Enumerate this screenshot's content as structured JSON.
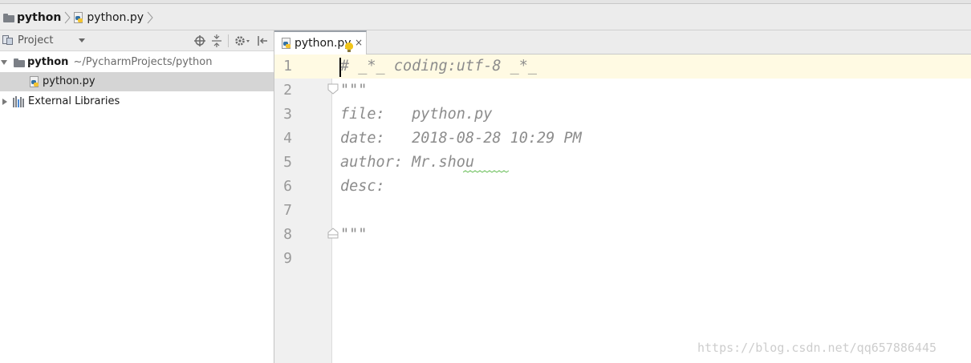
{
  "breadcrumb": {
    "project": "python",
    "file": "python.py"
  },
  "project_panel": {
    "title": "Project",
    "tree": [
      {
        "label": "python",
        "path": "~/PycharmProjects/python",
        "expanded": true
      },
      {
        "label": "python.py",
        "selected": true
      },
      {
        "label": "External Libraries",
        "expanded": false
      }
    ]
  },
  "editor": {
    "tab_label": "python.py",
    "close_glyph": "×",
    "lines": [
      {
        "num": "1",
        "text": "# _*_ coding:utf-8 _*_"
      },
      {
        "num": "2",
        "text": "\"\"\""
      },
      {
        "num": "3",
        "text": "file:   python.py"
      },
      {
        "num": "4",
        "text": "date:   2018-08-28 10:29 PM"
      },
      {
        "num": "5",
        "text": "author: Mr.shou"
      },
      {
        "num": "6",
        "text": "desc:"
      },
      {
        "num": "7",
        "text": ""
      },
      {
        "num": "8",
        "text": "\"\"\""
      },
      {
        "num": "9",
        "text": ""
      }
    ]
  },
  "watermark": "https://blog.csdn.net/qq657886445",
  "colors": {
    "current_line": "#fffae3",
    "comment_text": "#8c8c8c",
    "selection": "#d5d5d5",
    "spellcheck": "#6abf5a"
  }
}
